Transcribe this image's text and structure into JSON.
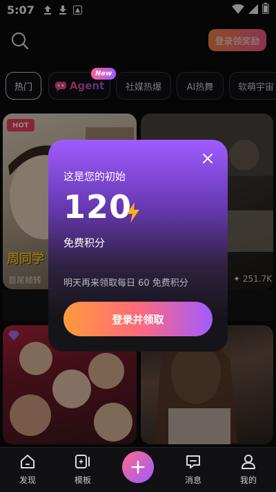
{
  "status_bar": {
    "time": "5:07"
  },
  "header": {
    "login_reward_label": "登录领奖励"
  },
  "tabs": [
    {
      "label": "热门"
    },
    {
      "label": "Agent",
      "badge": "New"
    },
    {
      "label": "社媒热爆"
    },
    {
      "label": "AI热舞"
    },
    {
      "label": "软萌宇宙"
    }
  ],
  "feed": {
    "card1": {
      "badge": "HOT",
      "title": "周同学",
      "subtitle": "首尾帧转"
    },
    "card2": {
      "stat": "✦ 251.7K"
    }
  },
  "modal": {
    "eyebrow": "这是您的初始",
    "amount": "120",
    "unit": "免费积分",
    "note": "明天再来领取每日 60 免费积分",
    "cta": "登录并领取"
  },
  "bottom_nav": [
    {
      "label": "发现",
      "icon": "home-icon"
    },
    {
      "label": "模板",
      "icon": "template-icon"
    },
    {
      "label": "",
      "icon": "plus-icon"
    },
    {
      "label": "消息",
      "icon": "message-icon"
    },
    {
      "label": "我的",
      "icon": "profile-icon"
    }
  ],
  "colors": {
    "accent_orange": "#ff8a4c",
    "accent_pink": "#ff5f8d",
    "accent_purple": "#a05bff",
    "bolt": "#ffb020"
  }
}
